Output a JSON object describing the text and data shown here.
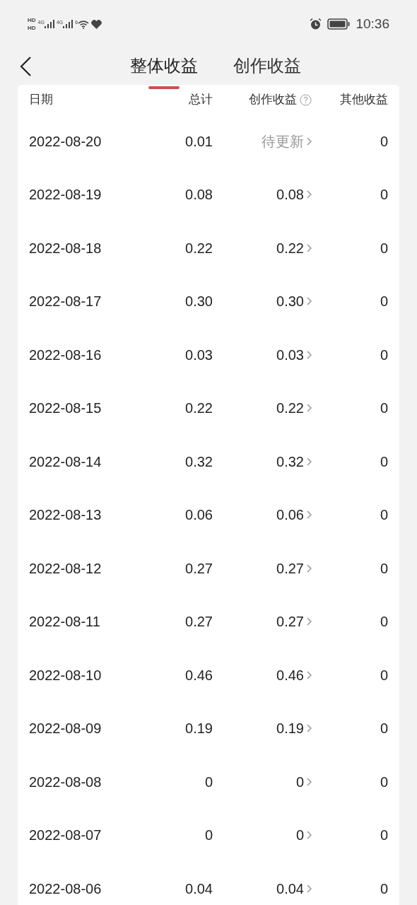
{
  "status_bar": {
    "sim_labels": [
      "HD",
      "HD"
    ],
    "network_labels": [
      "4G",
      "4G",
      "6"
    ],
    "time": "10:36"
  },
  "tabs": [
    {
      "label": "整体收益",
      "selected": true
    },
    {
      "label": "创作收益",
      "selected": false
    }
  ],
  "table": {
    "columns": [
      "日期",
      "总计",
      "创作收益",
      "其他收益"
    ],
    "rows": [
      {
        "date": "2022-08-20",
        "total": "0.01",
        "creative": "待更新",
        "pending": true,
        "other": "0"
      },
      {
        "date": "2022-08-19",
        "total": "0.08",
        "creative": "0.08",
        "pending": false,
        "other": "0"
      },
      {
        "date": "2022-08-18",
        "total": "0.22",
        "creative": "0.22",
        "pending": false,
        "other": "0"
      },
      {
        "date": "2022-08-17",
        "total": "0.30",
        "creative": "0.30",
        "pending": false,
        "other": "0"
      },
      {
        "date": "2022-08-16",
        "total": "0.03",
        "creative": "0.03",
        "pending": false,
        "other": "0"
      },
      {
        "date": "2022-08-15",
        "total": "0.22",
        "creative": "0.22",
        "pending": false,
        "other": "0"
      },
      {
        "date": "2022-08-14",
        "total": "0.32",
        "creative": "0.32",
        "pending": false,
        "other": "0"
      },
      {
        "date": "2022-08-13",
        "total": "0.06",
        "creative": "0.06",
        "pending": false,
        "other": "0"
      },
      {
        "date": "2022-08-12",
        "total": "0.27",
        "creative": "0.27",
        "pending": false,
        "other": "0"
      },
      {
        "date": "2022-08-11",
        "total": "0.27",
        "creative": "0.27",
        "pending": false,
        "other": "0"
      },
      {
        "date": "2022-08-10",
        "total": "0.46",
        "creative": "0.46",
        "pending": false,
        "other": "0"
      },
      {
        "date": "2022-08-09",
        "total": "0.19",
        "creative": "0.19",
        "pending": false,
        "other": "0"
      },
      {
        "date": "2022-08-08",
        "total": "0",
        "creative": "0",
        "pending": false,
        "other": "0"
      },
      {
        "date": "2022-08-07",
        "total": "0",
        "creative": "0",
        "pending": false,
        "other": "0"
      },
      {
        "date": "2022-08-06",
        "total": "0.04",
        "creative": "0.04",
        "pending": false,
        "other": "0"
      }
    ]
  }
}
